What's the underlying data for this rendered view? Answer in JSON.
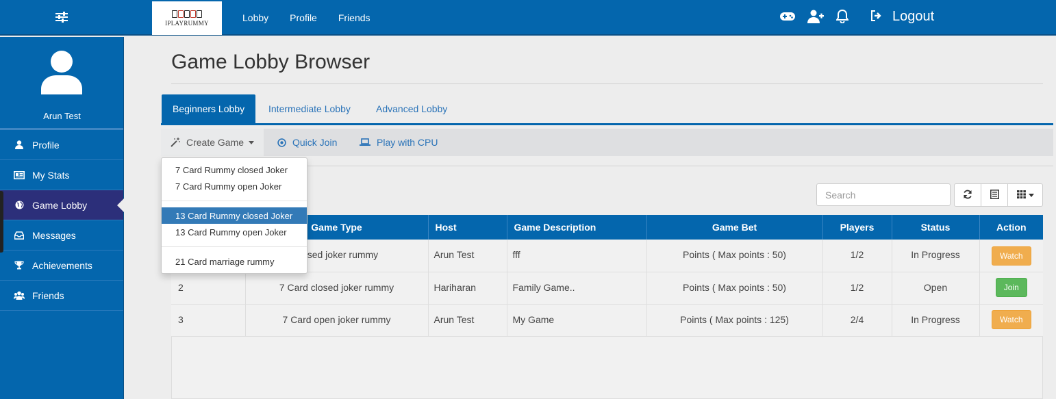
{
  "app": {
    "logo_text": "IPLAYRUMMY",
    "nav": [
      "Lobby",
      "Profile",
      "Friends"
    ],
    "logout_label": "Logout"
  },
  "sidebar": {
    "username": "Arun Test",
    "items": [
      {
        "label": "Profile",
        "icon": "user-icon"
      },
      {
        "label": "My Stats",
        "icon": "stats-card-icon"
      },
      {
        "label": "Game Lobby",
        "icon": "globe-icon",
        "active": true
      },
      {
        "label": "Messages",
        "icon": "inbox-icon"
      },
      {
        "label": "Achievements",
        "icon": "trophy-icon"
      },
      {
        "label": "Friends",
        "icon": "users-icon"
      }
    ]
  },
  "page": {
    "title": "Game Lobby Browser"
  },
  "tabs": [
    "Beginners Lobby",
    "Intermediate Lobby",
    "Advanced Lobby"
  ],
  "toolbar": {
    "create_game": "Create Game",
    "quick_join": "Quick Join",
    "play_cpu": "Play with CPU"
  },
  "dropdown": {
    "items": [
      "7 Card Rummy closed Joker",
      "7 Card Rummy open Joker",
      "13 Card Rummy closed Joker",
      "13 Card Rummy open Joker",
      "21 Card marriage rummy"
    ],
    "selected": "13 Card Rummy closed Joker"
  },
  "search": {
    "placeholder": "Search"
  },
  "table": {
    "columns": [
      "Game Type",
      "Host",
      "Game Description",
      "Game Bet",
      "Players",
      "Status",
      "Action"
    ],
    "rows": [
      {
        "id": "",
        "game_type": "closed joker rummy",
        "host": "Arun Test",
        "description": "fff",
        "bet": "Points ( Max points : 50)",
        "players": "1/2",
        "status": "In Progress",
        "action": "Watch"
      },
      {
        "id": "2",
        "game_type": "7 Card closed joker rummy",
        "host": "Hariharan",
        "description": "Family Game..",
        "bet": "Points ( Max points : 50)",
        "players": "1/2",
        "status": "Open",
        "action": "Join"
      },
      {
        "id": "3",
        "game_type": "7 Card open joker rummy",
        "host": "Arun Test",
        "description": "My Game",
        "bet": "Points ( Max points : 125)",
        "players": "2/4",
        "status": "In Progress",
        "action": "Watch"
      }
    ]
  },
  "colors": {
    "primary": "#0466ad",
    "sidebar_active": "#2c2f7a",
    "watch": "#f0ad4e",
    "join": "#5cb85c"
  }
}
